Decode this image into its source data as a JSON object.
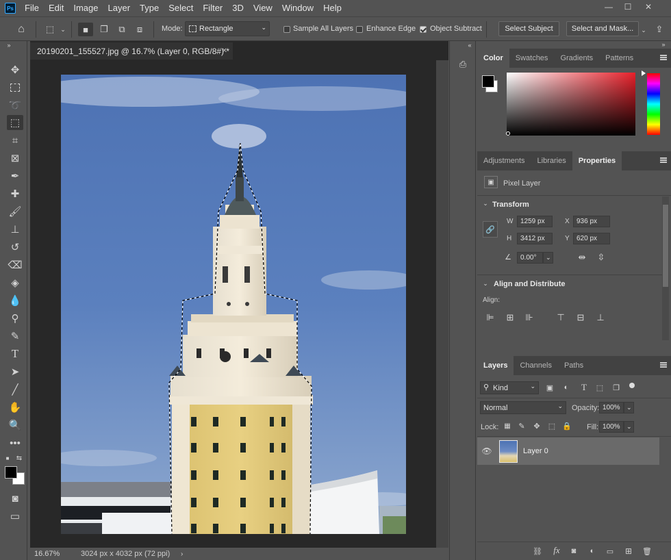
{
  "menu": {
    "items": [
      "File",
      "Edit",
      "Image",
      "Layer",
      "Type",
      "Select",
      "Filter",
      "3D",
      "View",
      "Window",
      "Help"
    ],
    "logo": "Ps"
  },
  "options": {
    "mode_label": "Mode:",
    "mode_value": "Rectangle",
    "sample_all_layers": "Sample All Layers",
    "enhance_edge": "Enhance Edge",
    "object_subtract": "Object Subtract",
    "select_subject": "Select Subject",
    "select_and_mask": "Select and Mask...",
    "sample_all_layers_checked": false,
    "enhance_edge_checked": false,
    "object_subtract_checked": true
  },
  "document": {
    "tab_title": "20190201_155527.jpg @ 16.7% (Layer 0, RGB/8#) *",
    "zoom": "16.67%",
    "info": "3024 px x 4032 px (72 ppi)"
  },
  "color_panel": {
    "tabs": [
      "Color",
      "Swatches",
      "Gradients",
      "Patterns"
    ],
    "active": "Color",
    "foreground": "#000000",
    "background": "#ffffff"
  },
  "properties_panel": {
    "tabs": [
      "Adjustments",
      "Libraries",
      "Properties"
    ],
    "active": "Properties",
    "layer_kind": "Pixel Layer",
    "transform_title": "Transform",
    "w_label": "W",
    "w_value": "1259 px",
    "h_label": "H",
    "h_value": "3412 px",
    "x_label": "X",
    "x_value": "936 px",
    "y_label": "Y",
    "y_value": "620 px",
    "angle_value": "0.00°",
    "align_title": "Align and Distribute",
    "align_label": "Align:"
  },
  "layers_panel": {
    "tabs": [
      "Layers",
      "Channels",
      "Paths"
    ],
    "active": "Layers",
    "filter_kind": "Kind",
    "blend_mode": "Normal",
    "opacity_label": "Opacity:",
    "opacity_value": "100%",
    "lock_label": "Lock:",
    "fill_label": "Fill:",
    "fill_value": "100%",
    "layers": [
      {
        "name": "Layer 0",
        "visible": true
      }
    ]
  }
}
